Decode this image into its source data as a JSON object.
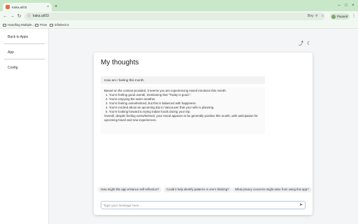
{
  "browser": {
    "tab_title": "Kaka.ai/03",
    "tab_close": "×",
    "new_tab": "+",
    "url": "kaka.ai/03",
    "url_extra": "Bny",
    "profile_name": "Paused",
    "bookmarks": [
      "Handling Multiple...",
      "Prise",
      "infinitecinc"
    ]
  },
  "sidebar": {
    "items": [
      {
        "label": "Back to Apps"
      },
      {
        "label": "App"
      },
      {
        "label": "Config"
      }
    ]
  },
  "page": {
    "title": "My thoughts",
    "question": "How am I feeling this month",
    "answer": {
      "intro": "Based on the context provided, it seems you are experiencing mixed emotions this month:",
      "items": [
        "1. You're feeling good overall, mentioning that \"Today is good.\".",
        "2. You're enjoying the warm weather.",
        "3. You're feeling overwhelmed, but this is balanced with happiness.",
        "4. You're excited about an upcoming trip to Vancouver that your wife is planning.",
        "5. You're looking forward to trying Indian foods during your trip."
      ],
      "conclusion": "Overall, despite feeling overwhelmed, your mood appears to be generally positive this month, with anticipation for upcoming travel and new experiences."
    },
    "suggestions": [
      "How might this app enhance self-reflection?",
      "Could it help identify patterns in one's thinking?",
      "What privacy concerns might arise from using this app?"
    ],
    "input_placeholder": "Type your message here..."
  },
  "icons": {
    "share": "share-icon",
    "theme": "moon-icon",
    "send": "send-icon"
  },
  "colors": {
    "tabbar": "#c9e8c9",
    "card": "#ffffff",
    "page_bg": "#f4f5f7"
  }
}
